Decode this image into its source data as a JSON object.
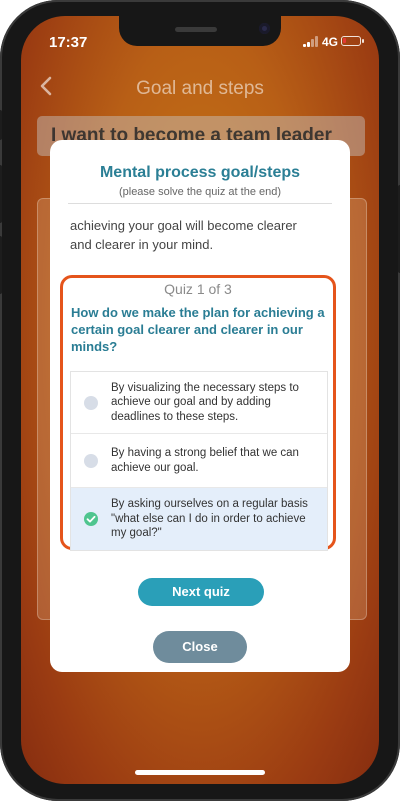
{
  "status_bar": {
    "time": "17:37",
    "network": "4G",
    "battery_color": "#e53935"
  },
  "header": {
    "title": "Goal and steps",
    "back_icon": "chevron-left-icon"
  },
  "goal": {
    "text": "I want to become a team leader"
  },
  "modal": {
    "title": "Mental process goal/steps",
    "subtitle": "(please solve the quiz at the end)",
    "intro_line1": "achieving your goal will become clearer",
    "intro_line2": "and clearer in your mind.",
    "quiz": {
      "counter": "Quiz 1 of 3",
      "question": "How do we make the plan for achieving a certain goal clearer and clearer in our minds?",
      "options": [
        {
          "text": "By visualizing the necessary steps to achieve our goal and by adding deadlines to these steps.",
          "selected": false
        },
        {
          "text": "By having a strong belief that we can achieve our goal.",
          "selected": false
        },
        {
          "text": "By asking ourselves on a regular basis \"what else can I do in order to achieve my goal?\"",
          "selected": true
        }
      ],
      "highlight_color": "#e5541b",
      "selected_color": "#4fc58f"
    },
    "next_button": "Next quiz",
    "close_button": "Close"
  },
  "colors": {
    "accent": "#2a7d94",
    "button_primary": "#2a9fb8",
    "button_secondary": "#6f8c9c"
  }
}
